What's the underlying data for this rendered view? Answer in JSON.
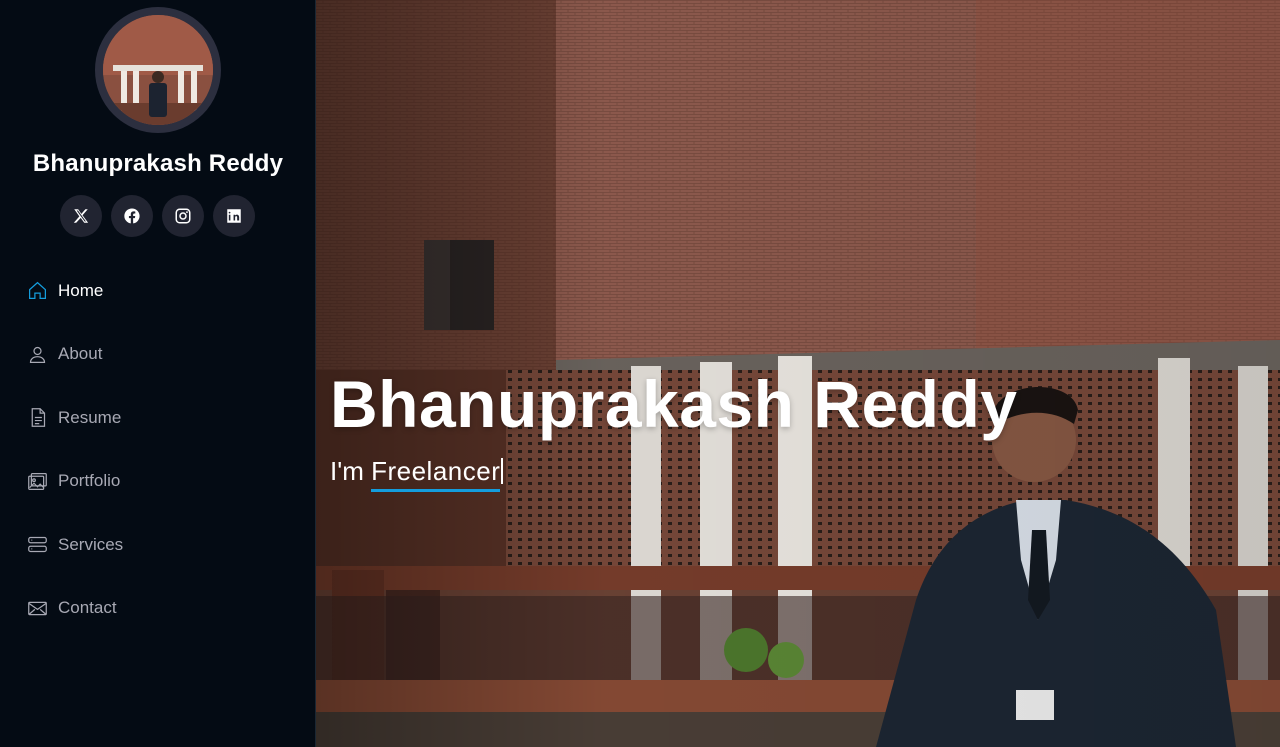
{
  "profile": {
    "name": "Bhanuprakash Reddy"
  },
  "social": [
    {
      "icon": "x-twitter-icon"
    },
    {
      "icon": "facebook-icon"
    },
    {
      "icon": "instagram-icon"
    },
    {
      "icon": "linkedin-icon"
    }
  ],
  "nav": {
    "items": [
      {
        "label": "Home",
        "icon": "house-icon",
        "active": true
      },
      {
        "label": "About",
        "icon": "person-icon"
      },
      {
        "label": "Resume",
        "icon": "file-text-icon"
      },
      {
        "label": "Portfolio",
        "icon": "images-icon"
      },
      {
        "label": "Services",
        "icon": "server-icon"
      },
      {
        "label": "Contact",
        "icon": "envelope-icon"
      }
    ]
  },
  "hero": {
    "title": "Bhanuprakash Reddy",
    "prefix": "I'm ",
    "typed": "Freelancer"
  },
  "colors": {
    "accent": "#149ddd",
    "sidebar_bg": "#040b14",
    "nav_text": "#a8a9b4",
    "social_bg": "#212431"
  }
}
